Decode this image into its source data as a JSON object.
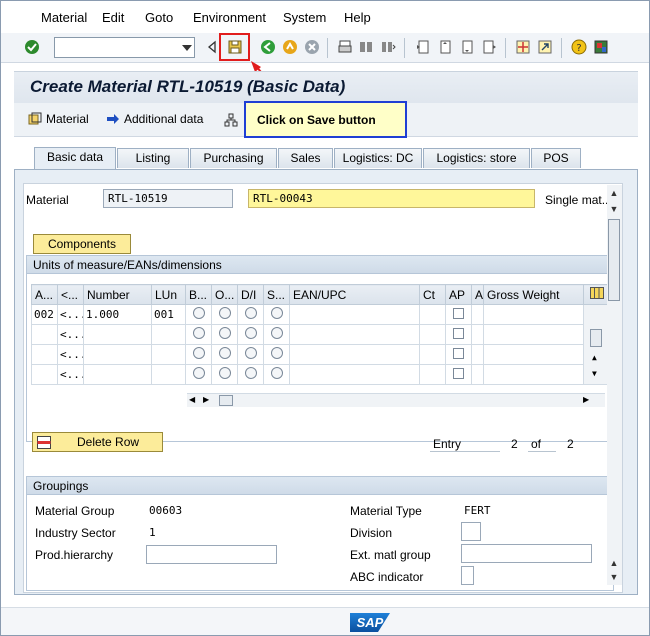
{
  "menu": {
    "items": [
      "Material",
      "Edit",
      "Goto",
      "Environment",
      "System",
      "Help"
    ]
  },
  "toolbar": {
    "command_field_value": ""
  },
  "page": {
    "title": "Create Material RTL-10519 (Basic Data)"
  },
  "app_toolbar": {
    "material_label": "Material",
    "additional_data_label": "Additional data"
  },
  "callout": {
    "text": "Click on Save button"
  },
  "tabs": [
    "Basic data",
    "Listing",
    "Purchasing",
    "Sales",
    "Logistics: DC",
    "Logistics: store",
    "POS"
  ],
  "header": {
    "material_label": "Material",
    "material_value": "RTL-10519",
    "description_value": "RTL-00043",
    "description_type": "Single mat..."
  },
  "components_button": "Components",
  "uom_section": {
    "title": "Units of measure/EANs/dimensions",
    "columns": [
      "A...",
      "<...",
      "Number",
      "LUn",
      "B...",
      "O...",
      "D/I",
      "S...",
      "EAN/UPC",
      "Ct",
      "AP",
      "A",
      "Gross Weight"
    ],
    "rows": [
      {
        "a": "002",
        "b": "<...",
        "number": "1.000",
        "lun": "001"
      },
      {
        "a": "",
        "b": "<...",
        "number": "",
        "lun": ""
      },
      {
        "a": "",
        "b": "<...",
        "number": "",
        "lun": ""
      },
      {
        "a": "",
        "b": "<...",
        "number": "",
        "lun": ""
      }
    ],
    "delete_row_label": "Delete Row",
    "entry_label": "Entry",
    "entry_current": "2",
    "entry_of": "of",
    "entry_total": "2"
  },
  "groupings": {
    "title": "Groupings",
    "material_group_label": "Material Group",
    "material_group_value": "00603",
    "industry_sector_label": "Industry Sector",
    "industry_sector_value": "1",
    "prod_hierarchy_label": "Prod.hierarchy",
    "prod_hierarchy_value": "",
    "material_type_label": "Material Type",
    "material_type_value": "FERT",
    "division_label": "Division",
    "division_value": "",
    "ext_matl_group_label": "Ext. matl group",
    "ext_matl_group_value": "",
    "abc_indicator_label": "ABC indicator",
    "abc_indicator_value": ""
  },
  "footer": {
    "logo_text": "SAP"
  },
  "colors": {
    "highlight_red": "#e11d1d",
    "callout_border": "#1f3fd4",
    "callout_fill": "#ffffc8",
    "required_field": "#fff79a",
    "button_fill": "#fcec9a"
  }
}
